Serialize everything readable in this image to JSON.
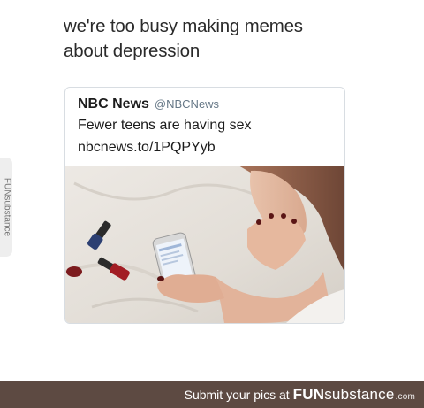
{
  "caption": {
    "line1": "we're too busy making memes",
    "line2": "about depression"
  },
  "tweet": {
    "author_name": "NBC News",
    "author_handle": "@NBCNews",
    "text": "Fewer teens are having sex",
    "link": "nbcnews.to/1PQPYyb"
  },
  "side_watermark": "FUNsubstance",
  "footer": {
    "prompt": "Submit your pics at",
    "brand_bold": "FUN",
    "brand_rest": "substance",
    "brand_tld": ".com"
  },
  "colors": {
    "footer_bg": "#5d4a42",
    "handle": "#657786",
    "card_border": "#d8dde2"
  }
}
